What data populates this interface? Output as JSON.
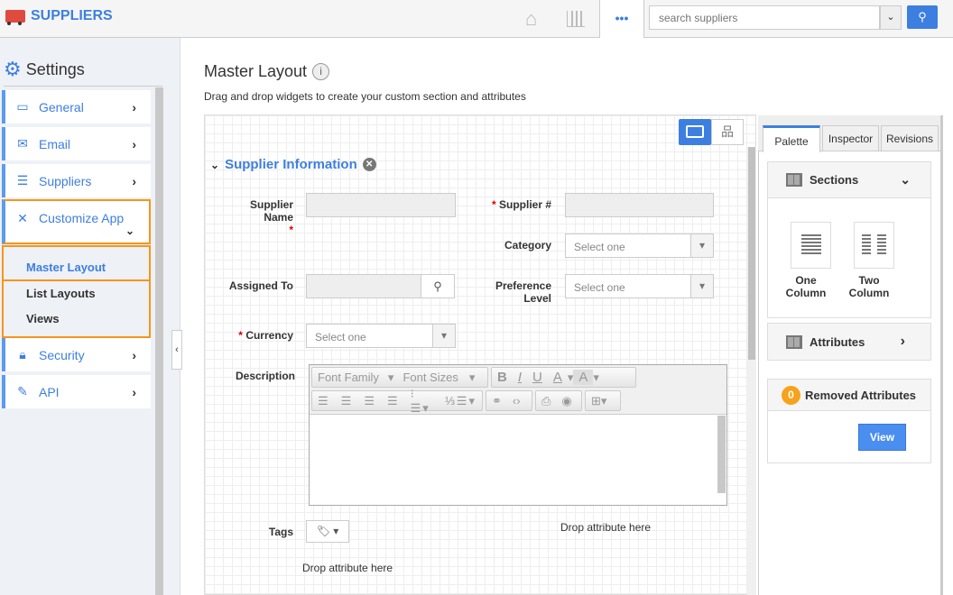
{
  "app": {
    "title": "SUPPLIERS",
    "search_placeholder": "search suppliers",
    "more": "•••"
  },
  "sidebar": {
    "title": "Settings",
    "items": [
      {
        "label": "General",
        "icon": "monitor-icon"
      },
      {
        "label": "Email",
        "icon": "envelope-icon"
      },
      {
        "label": "Suppliers",
        "icon": "list-icon"
      },
      {
        "label": "Customize App",
        "icon": "tools-icon"
      },
      {
        "label": "Security",
        "icon": "lock-icon"
      },
      {
        "label": "API",
        "icon": "plug-icon"
      }
    ],
    "subitems": [
      {
        "label": "Master Layout",
        "active": true
      },
      {
        "label": "List Layouts"
      },
      {
        "label": "Views"
      }
    ]
  },
  "page": {
    "title": "Master Layout",
    "subtitle": "Drag and drop widgets to create your custom section and attributes"
  },
  "section": {
    "title": "Supplier Information",
    "fields": {
      "supplier_name": "Supplier Name",
      "supplier_no": "Supplier #",
      "category": "Category",
      "assigned_to": "Assigned To",
      "preference_level": "Preference Level",
      "currency": "Currency",
      "description": "Description",
      "tags": "Tags"
    },
    "select_placeholder": "Select one",
    "drop_here": "Drop attribute here",
    "required_mark": "*"
  },
  "editor": {
    "font_family": "Font Family",
    "font_sizes": "Font Sizes",
    "bold": "B",
    "italic": "I",
    "underline": "U",
    "color": "A"
  },
  "palette": {
    "tabs": [
      "Palette",
      "Inspector",
      "Revisions"
    ],
    "active_tab": "Palette",
    "sections": "Sections",
    "one_column": "One Column",
    "two_column": "Two Column",
    "attributes": "Attributes",
    "removed_count": "0",
    "removed": "Removed Attributes",
    "view": "View"
  },
  "colors": {
    "accent": "#3d7fe0",
    "highlight": "#f7941d",
    "button": "#4a8ef0"
  }
}
